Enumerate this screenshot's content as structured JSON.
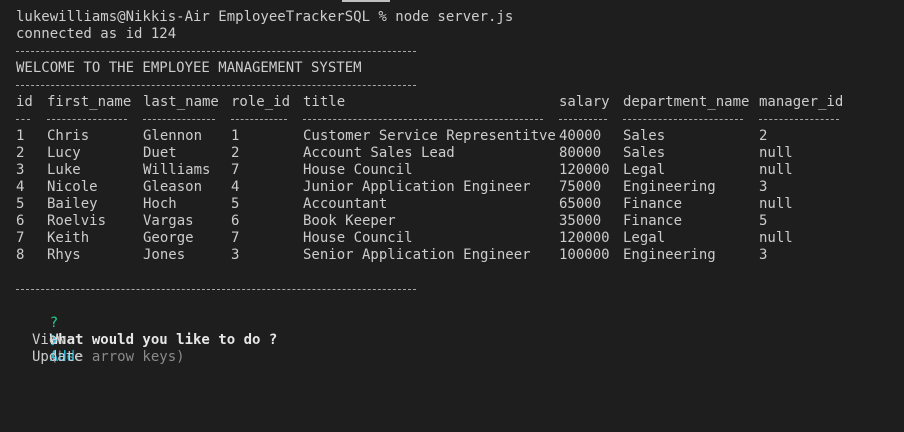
{
  "prompt_line": "lukewilliams@Nikkis-Air EmployeeTrackerSQL % node server.js",
  "connected": "connected as id 124",
  "banner": "WELCOME TO THE EMPLOYEE MANAGEMENT SYSTEM",
  "table": {
    "headers": [
      "id",
      "first_name",
      "last_name",
      "role_id",
      "title",
      "salary",
      "department_name",
      "manager_id"
    ],
    "rows": [
      [
        "1",
        "Chris",
        "Glennon",
        "1",
        "Customer Service Representitve",
        "40000",
        "Sales",
        "2"
      ],
      [
        "2",
        "Lucy",
        "Duet",
        "2",
        "Account Sales Lead",
        "80000",
        "Sales",
        "null"
      ],
      [
        "3",
        "Luke",
        "Williams",
        "7",
        "House Council",
        "120000",
        "Legal",
        "null"
      ],
      [
        "4",
        "Nicole",
        "Gleason",
        "4",
        "Junior Application Engineer",
        "75000",
        "Engineering",
        "3"
      ],
      [
        "5",
        "Bailey",
        "Hoch",
        "5",
        "Accountant",
        "65000",
        "Finance",
        "null"
      ],
      [
        "6",
        "Roelvis",
        "Vargas",
        "6",
        "Book Keeper",
        "35000",
        "Finance",
        "5"
      ],
      [
        "7",
        "Keith",
        "George",
        "7",
        "House Council",
        "120000",
        "Legal",
        "null"
      ],
      [
        "8",
        "Rhys",
        "Jones",
        "3",
        "Senior Application Engineer",
        "100000",
        "Engineering",
        "3"
      ]
    ]
  },
  "question": {
    "mark": "?",
    "text": "What would you like to do ?",
    "hint": "(Use arrow keys)"
  },
  "pointer": "❯",
  "choices": [
    "Add",
    "View",
    "Update"
  ],
  "colors": {
    "background": "#1e1e1e",
    "text": "#cccccc",
    "question_mark": "#23d18b",
    "selected": "#29b8db",
    "hint": "#8a8a8a"
  }
}
